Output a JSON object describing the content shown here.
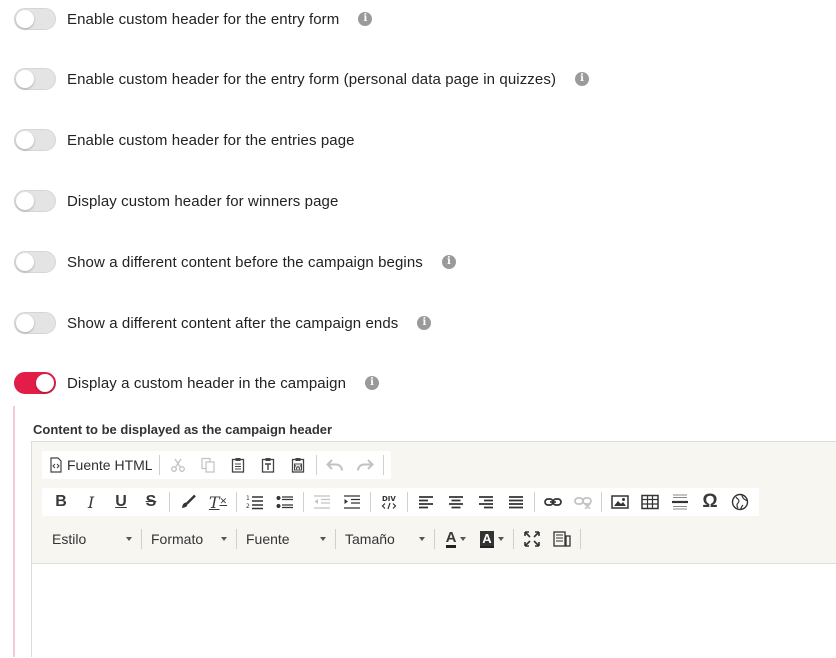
{
  "toggles": [
    {
      "label": "Enable custom header for the entry form",
      "on": false,
      "info": true
    },
    {
      "label": "Enable custom header for the entry form (personal data page in quizzes)",
      "on": false,
      "info": true
    },
    {
      "label": "Enable custom header for the entries page",
      "on": false,
      "info": false
    },
    {
      "label": "Display custom header for winners page",
      "on": false,
      "info": false
    },
    {
      "label": "Show a different content before the campaign begins",
      "on": false,
      "info": true
    },
    {
      "label": "Show a different content after the campaign ends",
      "on": false,
      "info": true
    },
    {
      "label": "Display a custom header in the campaign",
      "on": true,
      "info": true
    }
  ],
  "colors": {
    "accent": "#e11d48",
    "toggle_off": "#e4e4e4",
    "info_icon": "#9a9a9a",
    "toolbar_bg": "#f8f6f1",
    "section_border": "#f4c9d3"
  },
  "info_glyph": "i",
  "section": {
    "label": "Content to be displayed as the campaign header"
  },
  "editor": {
    "source_label": "Fuente HTML",
    "bold": "B",
    "italic": "I",
    "underline": "U",
    "strike": "S",
    "remove_format": "T",
    "special_char": "Ω",
    "combos": {
      "style": "Estilo",
      "format": "Formato",
      "font": "Fuente",
      "size": "Tamaño"
    },
    "text_color": "A",
    "bg_color": "A"
  }
}
